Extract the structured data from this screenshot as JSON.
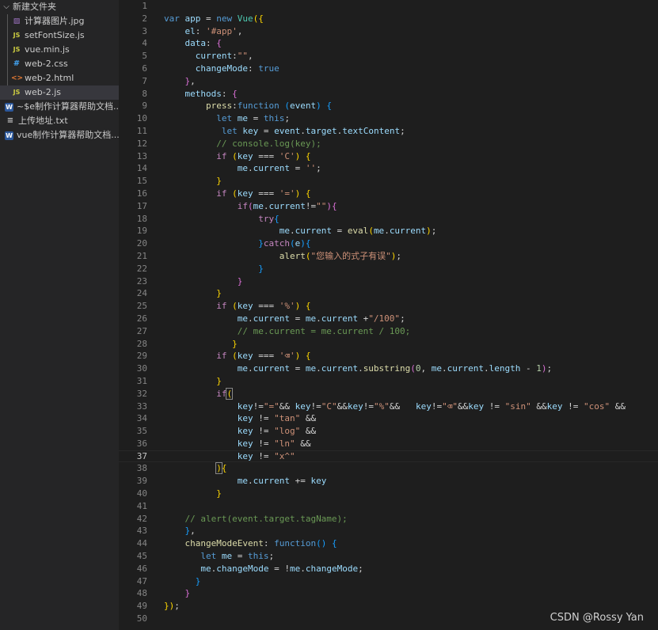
{
  "explorer": {
    "folder_name": "新建文件夹",
    "folder_files": [
      {
        "name": "计算器图片.jpg",
        "icon": "image-file-icon",
        "type": "img",
        "glyph": "▨",
        "selected": false
      },
      {
        "name": "setFontSize.js",
        "icon": "js-file-icon",
        "type": "js",
        "glyph": "JS",
        "selected": false
      },
      {
        "name": "vue.min.js",
        "icon": "js-file-icon",
        "type": "js",
        "glyph": "JS",
        "selected": false
      },
      {
        "name": "web-2.css",
        "icon": "css-file-icon",
        "type": "css",
        "glyph": "#",
        "selected": false
      },
      {
        "name": "web-2.html",
        "icon": "html-file-icon",
        "type": "html",
        "glyph": "<>",
        "selected": false
      },
      {
        "name": "web-2.js",
        "icon": "js-file-icon",
        "type": "js",
        "glyph": "JS",
        "selected": true
      }
    ],
    "other_files": [
      {
        "name": "~$e制作计算器帮助文档....",
        "icon": "word-file-icon",
        "type": "word",
        "glyph": "W"
      },
      {
        "name": "上传地址.txt",
        "icon": "text-file-icon",
        "type": "txt",
        "glyph": "≡"
      },
      {
        "name": "vue制作计算器帮助文档....",
        "icon": "word-file-icon",
        "type": "word",
        "glyph": "W"
      }
    ]
  },
  "editor": {
    "current_line": 37,
    "lines": [
      [],
      [
        [
          "kw",
          "var "
        ],
        [
          "var",
          "app"
        ],
        [
          "pu",
          " = "
        ],
        [
          "kw",
          "new "
        ],
        [
          "cls",
          "Vue"
        ],
        [
          "b1",
          "({"
        ]
      ],
      [
        [
          "pu",
          "    "
        ],
        [
          "var",
          "el"
        ],
        [
          "pu",
          ": "
        ],
        [
          "str",
          "'#app'"
        ],
        [
          "pu",
          ","
        ]
      ],
      [
        [
          "pu",
          "    "
        ],
        [
          "var",
          "data"
        ],
        [
          "pu",
          ": "
        ],
        [
          "b2",
          "{"
        ]
      ],
      [
        [
          "pu",
          "      "
        ],
        [
          "var",
          "current"
        ],
        [
          "pu",
          ":"
        ],
        [
          "str",
          "\"\""
        ],
        [
          "pu",
          ","
        ]
      ],
      [
        [
          "pu",
          "      "
        ],
        [
          "var",
          "changeMode"
        ],
        [
          "pu",
          ": "
        ],
        [
          "kw",
          "true"
        ]
      ],
      [
        [
          "pu",
          "    "
        ],
        [
          "b2",
          "}"
        ],
        [
          "pu",
          ","
        ]
      ],
      [
        [
          "pu",
          "    "
        ],
        [
          "var",
          "methods"
        ],
        [
          "pu",
          ": "
        ],
        [
          "b2",
          "{"
        ]
      ],
      [
        [
          "pu",
          "        "
        ],
        [
          "fn",
          "press"
        ],
        [
          "pu",
          ":"
        ],
        [
          "kw",
          "function "
        ],
        [
          "b3",
          "("
        ],
        [
          "var",
          "event"
        ],
        [
          "b3",
          ")"
        ],
        [
          "pu",
          " "
        ],
        [
          "b3",
          "{"
        ]
      ],
      [
        [
          "pu",
          "          "
        ],
        [
          "kw",
          "let "
        ],
        [
          "var",
          "me"
        ],
        [
          "pu",
          " = "
        ],
        [
          "kw",
          "this"
        ],
        [
          "pu",
          ";"
        ]
      ],
      [
        [
          "pu",
          "           "
        ],
        [
          "kw",
          "let "
        ],
        [
          "var",
          "key"
        ],
        [
          "pu",
          " = "
        ],
        [
          "var",
          "event"
        ],
        [
          "pu",
          "."
        ],
        [
          "var",
          "target"
        ],
        [
          "pu",
          "."
        ],
        [
          "var",
          "textContent"
        ],
        [
          "pu",
          ";"
        ]
      ],
      [
        [
          "pu",
          "          "
        ],
        [
          "cm",
          "// console.log(key);"
        ]
      ],
      [
        [
          "pu",
          "          "
        ],
        [
          "ctl",
          "if "
        ],
        [
          "b1",
          "("
        ],
        [
          "var",
          "key"
        ],
        [
          "pu",
          " === "
        ],
        [
          "str",
          "'C'"
        ],
        [
          "b1",
          ")"
        ],
        [
          "pu",
          " "
        ],
        [
          "b1",
          "{"
        ]
      ],
      [
        [
          "pu",
          "              "
        ],
        [
          "var",
          "me"
        ],
        [
          "pu",
          "."
        ],
        [
          "var",
          "current"
        ],
        [
          "pu",
          " = "
        ],
        [
          "str",
          "''"
        ],
        [
          "pu",
          ";"
        ]
      ],
      [
        [
          "pu",
          "          "
        ],
        [
          "b1",
          "}"
        ]
      ],
      [
        [
          "pu",
          "          "
        ],
        [
          "ctl",
          "if "
        ],
        [
          "b1",
          "("
        ],
        [
          "var",
          "key"
        ],
        [
          "pu",
          " === "
        ],
        [
          "str",
          "'='"
        ],
        [
          "b1",
          ")"
        ],
        [
          "pu",
          " "
        ],
        [
          "b1",
          "{"
        ]
      ],
      [
        [
          "pu",
          "              "
        ],
        [
          "ctl",
          "if"
        ],
        [
          "b2",
          "("
        ],
        [
          "var",
          "me"
        ],
        [
          "pu",
          "."
        ],
        [
          "var",
          "current"
        ],
        [
          "pu",
          "!="
        ],
        [
          "str",
          "\"\""
        ],
        [
          "b2",
          ")"
        ],
        [
          "b2",
          "{"
        ]
      ],
      [
        [
          "pu",
          "                  "
        ],
        [
          "ctl",
          "try"
        ],
        [
          "b3",
          "{"
        ]
      ],
      [
        [
          "pu",
          "                      "
        ],
        [
          "var",
          "me"
        ],
        [
          "pu",
          "."
        ],
        [
          "var",
          "current"
        ],
        [
          "pu",
          " = "
        ],
        [
          "fn",
          "eval"
        ],
        [
          "b1",
          "("
        ],
        [
          "var",
          "me"
        ],
        [
          "pu",
          "."
        ],
        [
          "var",
          "current"
        ],
        [
          "b1",
          ")"
        ],
        [
          "pu",
          ";"
        ]
      ],
      [
        [
          "pu",
          "                  "
        ],
        [
          "b3",
          "}"
        ],
        [
          "ctl",
          "catch"
        ],
        [
          "b3",
          "("
        ],
        [
          "var",
          "e"
        ],
        [
          "b3",
          ")"
        ],
        [
          "b3",
          "{"
        ]
      ],
      [
        [
          "pu",
          "                      "
        ],
        [
          "fn",
          "alert"
        ],
        [
          "b1",
          "("
        ],
        [
          "str",
          "\"您输入的式子有误\""
        ],
        [
          "b1",
          ")"
        ],
        [
          "pu",
          ";"
        ]
      ],
      [
        [
          "pu",
          "                  "
        ],
        [
          "b3",
          "}"
        ]
      ],
      [
        [
          "pu",
          "              "
        ],
        [
          "b2",
          "}"
        ]
      ],
      [
        [
          "pu",
          "          "
        ],
        [
          "b1",
          "}"
        ]
      ],
      [
        [
          "pu",
          "          "
        ],
        [
          "ctl",
          "if "
        ],
        [
          "b1",
          "("
        ],
        [
          "var",
          "key"
        ],
        [
          "pu",
          " === "
        ],
        [
          "str",
          "'%'"
        ],
        [
          "b1",
          ")"
        ],
        [
          "pu",
          " "
        ],
        [
          "b1",
          "{"
        ]
      ],
      [
        [
          "pu",
          "              "
        ],
        [
          "var",
          "me"
        ],
        [
          "pu",
          "."
        ],
        [
          "var",
          "current"
        ],
        [
          "pu",
          " = "
        ],
        [
          "var",
          "me"
        ],
        [
          "pu",
          "."
        ],
        [
          "var",
          "current"
        ],
        [
          "pu",
          " +"
        ],
        [
          "str",
          "\"/100\""
        ],
        [
          "pu",
          ";"
        ]
      ],
      [
        [
          "pu",
          "              "
        ],
        [
          "cm",
          "// me.current = me.current / 100;"
        ]
      ],
      [
        [
          "pu",
          "             "
        ],
        [
          "b1",
          "}"
        ]
      ],
      [
        [
          "pu",
          "          "
        ],
        [
          "ctl",
          "if "
        ],
        [
          "b1",
          "("
        ],
        [
          "var",
          "key"
        ],
        [
          "pu",
          " === "
        ],
        [
          "str",
          "'⌫'"
        ],
        [
          "b1",
          ")"
        ],
        [
          "pu",
          " "
        ],
        [
          "b1",
          "{"
        ]
      ],
      [
        [
          "pu",
          "              "
        ],
        [
          "var",
          "me"
        ],
        [
          "pu",
          "."
        ],
        [
          "var",
          "current"
        ],
        [
          "pu",
          " = "
        ],
        [
          "var",
          "me"
        ],
        [
          "pu",
          "."
        ],
        [
          "var",
          "current"
        ],
        [
          "pu",
          "."
        ],
        [
          "fn",
          "substring"
        ],
        [
          "b2",
          "("
        ],
        [
          "num",
          "0"
        ],
        [
          "pu",
          ", "
        ],
        [
          "var",
          "me"
        ],
        [
          "pu",
          "."
        ],
        [
          "var",
          "current"
        ],
        [
          "pu",
          "."
        ],
        [
          "var",
          "length"
        ],
        [
          "pu",
          " - "
        ],
        [
          "num",
          "1"
        ],
        [
          "b2",
          ")"
        ],
        [
          "pu",
          ";"
        ]
      ],
      [
        [
          "pu",
          "          "
        ],
        [
          "b1",
          "}"
        ]
      ],
      [
        [
          "pu",
          "          "
        ],
        [
          "ctl",
          "if"
        ],
        [
          "b1 bm",
          "("
        ]
      ],
      [
        [
          "pu",
          "              "
        ],
        [
          "var",
          "key"
        ],
        [
          "pu",
          "!="
        ],
        [
          "str",
          "\"=\""
        ],
        [
          "pu",
          "&& "
        ],
        [
          "var",
          "key"
        ],
        [
          "pu",
          "!="
        ],
        [
          "str",
          "\"C\""
        ],
        [
          "pu",
          "&&"
        ],
        [
          "var",
          "key"
        ],
        [
          "pu",
          "!="
        ],
        [
          "str",
          "\"%\""
        ],
        [
          "pu",
          "&&   "
        ],
        [
          "var",
          "key"
        ],
        [
          "pu",
          "!="
        ],
        [
          "str",
          "\"⌫\""
        ],
        [
          "pu",
          "&&"
        ],
        [
          "var",
          "key"
        ],
        [
          "pu",
          " != "
        ],
        [
          "str",
          "\"sin\""
        ],
        [
          "pu",
          " &&"
        ],
        [
          "var",
          "key"
        ],
        [
          "pu",
          " != "
        ],
        [
          "str",
          "\"cos\""
        ],
        [
          "pu",
          " &&"
        ]
      ],
      [
        [
          "pu",
          "              "
        ],
        [
          "var",
          "key"
        ],
        [
          "pu",
          " != "
        ],
        [
          "str",
          "\"tan\""
        ],
        [
          "pu",
          " &&"
        ]
      ],
      [
        [
          "pu",
          "              "
        ],
        [
          "var",
          "key"
        ],
        [
          "pu",
          " != "
        ],
        [
          "str",
          "\"log\""
        ],
        [
          "pu",
          " &&"
        ]
      ],
      [
        [
          "pu",
          "              "
        ],
        [
          "var",
          "key"
        ],
        [
          "pu",
          " != "
        ],
        [
          "str",
          "\"ln\""
        ],
        [
          "pu",
          " &&"
        ]
      ],
      [
        [
          "pu",
          "              "
        ],
        [
          "var",
          "key"
        ],
        [
          "pu",
          " != "
        ],
        [
          "str",
          "\"x^\""
        ]
      ],
      [
        [
          "pu",
          "          "
        ],
        [
          "b1 bm",
          ")"
        ],
        [
          "b1",
          "{"
        ]
      ],
      [
        [
          "pu",
          "              "
        ],
        [
          "var",
          "me"
        ],
        [
          "pu",
          "."
        ],
        [
          "var",
          "current"
        ],
        [
          "pu",
          " += "
        ],
        [
          "var",
          "key"
        ]
      ],
      [
        [
          "pu",
          "          "
        ],
        [
          "b1",
          "}"
        ]
      ],
      [],
      [
        [
          "pu",
          "    "
        ],
        [
          "cm",
          "// alert(event.target.tagName);"
        ]
      ],
      [
        [
          "pu",
          "    "
        ],
        [
          "b3",
          "}"
        ],
        [
          "pu",
          ","
        ]
      ],
      [
        [
          "pu",
          "    "
        ],
        [
          "fn",
          "changeModeEvent"
        ],
        [
          "pu",
          ": "
        ],
        [
          "kw",
          "function"
        ],
        [
          "b3",
          "()"
        ],
        [
          "pu",
          " "
        ],
        [
          "b3",
          "{"
        ]
      ],
      [
        [
          "pu",
          "       "
        ],
        [
          "kw",
          "let "
        ],
        [
          "var",
          "me"
        ],
        [
          "pu",
          " = "
        ],
        [
          "kw",
          "this"
        ],
        [
          "pu",
          ";"
        ]
      ],
      [
        [
          "pu",
          "       "
        ],
        [
          "var",
          "me"
        ],
        [
          "pu",
          "."
        ],
        [
          "var",
          "changeMode"
        ],
        [
          "pu",
          " = !"
        ],
        [
          "var",
          "me"
        ],
        [
          "pu",
          "."
        ],
        [
          "var",
          "changeMode"
        ],
        [
          "pu",
          ";"
        ]
      ],
      [
        [
          "pu",
          "      "
        ],
        [
          "b3",
          "}"
        ]
      ],
      [
        [
          "pu",
          "    "
        ],
        [
          "b2",
          "}"
        ]
      ],
      [
        [
          "b1",
          "})"
        ],
        [
          "pu",
          ";"
        ]
      ],
      []
    ]
  },
  "watermark": "CSDN @Rossy Yan"
}
